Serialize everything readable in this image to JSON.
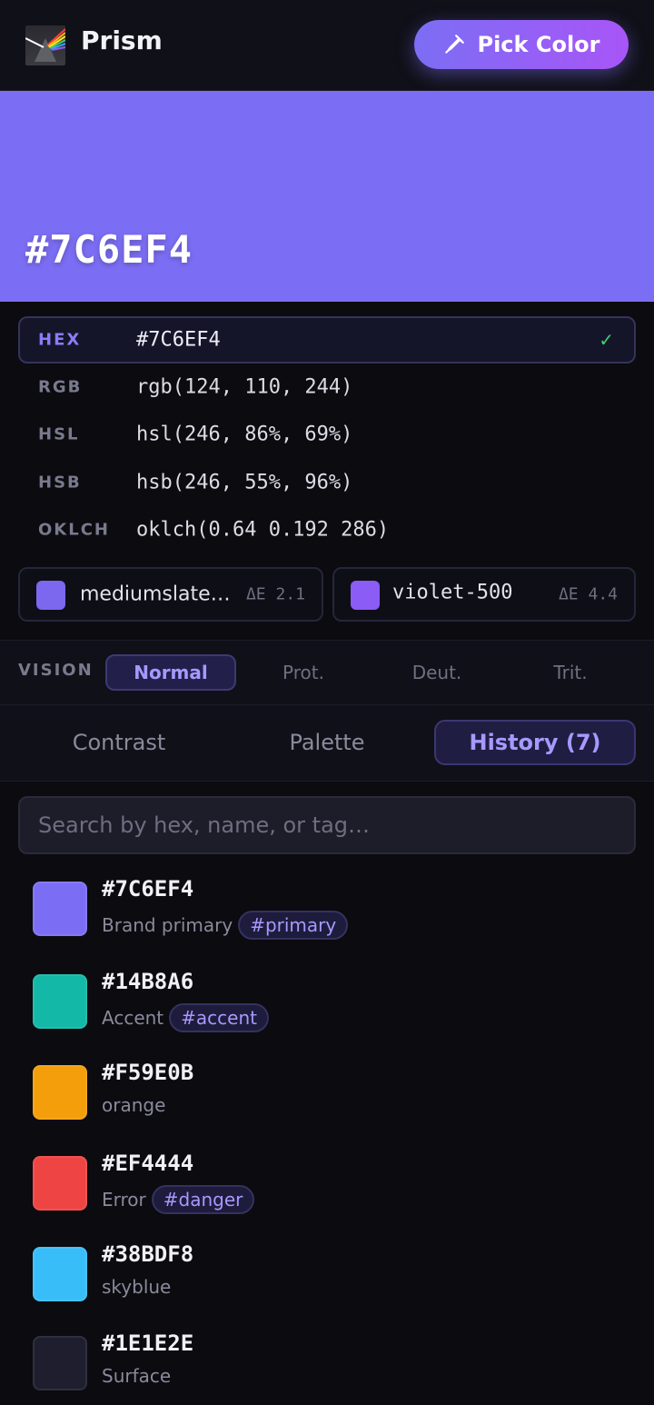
{
  "app": {
    "title": "Prism",
    "logo_icon": "prism-logo"
  },
  "header": {
    "pick_label": "Pick Color",
    "pick_icon": "eyedropper-icon"
  },
  "current": {
    "hex": "#7C6EF4",
    "color": "#7C6EF4"
  },
  "formats": [
    {
      "label": "HEX",
      "value": "#7C6EF4",
      "active": true,
      "check": "✓"
    },
    {
      "label": "RGB",
      "value": "rgb(124, 110, 244)"
    },
    {
      "label": "HSL",
      "value": "hsl(246, 86%, 69%)"
    },
    {
      "label": "HSB",
      "value": "hsb(246, 55%, 96%)"
    },
    {
      "label": "OKLCH",
      "value": "oklch(0.64 0.192 286)"
    }
  ],
  "nearest": [
    {
      "name": "mediumslate…",
      "delta": "ΔE 2.1",
      "color": "#7B68EE"
    },
    {
      "name": "violet-500",
      "delta": "ΔE 4.4",
      "color": "#8B5CF6"
    }
  ],
  "vision": {
    "label": "VISION",
    "options": [
      "Normal",
      "Prot.",
      "Deut.",
      "Trit."
    ],
    "selected": "Normal"
  },
  "tabs": [
    "Contrast",
    "Palette",
    "History (7)"
  ],
  "active_tab": "History (7)",
  "search": {
    "placeholder": "Search by hex, name, or tag…",
    "value": ""
  },
  "history": [
    {
      "hex": "#7C6EF4",
      "name": "Brand primary",
      "tag": "#primary",
      "color": "#7C6EF4"
    },
    {
      "hex": "#14B8A6",
      "name": "Accent",
      "tag": "#accent",
      "color": "#14B8A6"
    },
    {
      "hex": "#F59E0B",
      "name": "orange",
      "tag": "",
      "color": "#F59E0B"
    },
    {
      "hex": "#EF4444",
      "name": "Error",
      "tag": "#danger",
      "color": "#EF4444"
    },
    {
      "hex": "#38BDF8",
      "name": "skyblue",
      "tag": "",
      "color": "#38BDF8"
    },
    {
      "hex": "#1E1E2E",
      "name": "Surface",
      "tag": "",
      "color": "#1E1E2E"
    }
  ]
}
